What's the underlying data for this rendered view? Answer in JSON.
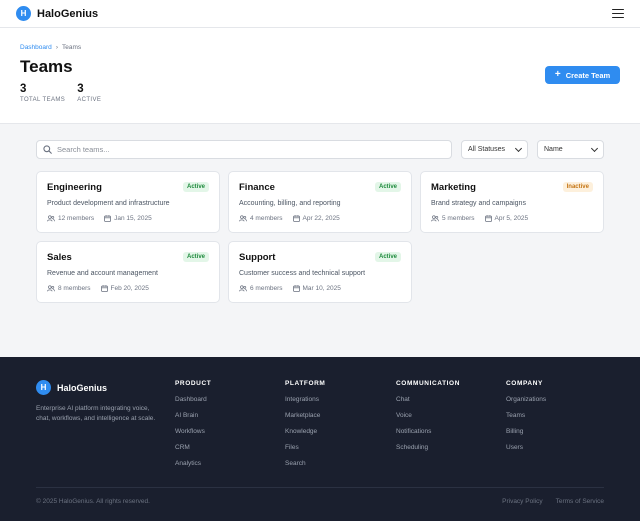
{
  "app": {
    "logo_letter": "H",
    "name": "HaloGenius"
  },
  "breadcrumb": {
    "parent": "Dashboard",
    "separator": "›",
    "current": "Teams"
  },
  "page": {
    "title": "Teams",
    "create_label": "Create Team"
  },
  "stats": [
    {
      "value": "3",
      "label": "TOTAL TEAMS"
    },
    {
      "value": "3",
      "label": "ACTIVE"
    }
  ],
  "filters": {
    "search_placeholder": "Search teams...",
    "status_selected": "All Statuses",
    "sort_selected": "Name"
  },
  "teams": [
    {
      "name": "Engineering",
      "status": "Active",
      "description": "Product development and infrastructure",
      "members": "12 members",
      "date": "Jan 15, 2025"
    },
    {
      "name": "Finance",
      "status": "Active",
      "description": "Accounting, billing, and reporting",
      "members": "4 members",
      "date": "Apr 22, 2025"
    },
    {
      "name": "Marketing",
      "status": "Inactive",
      "description": "Brand strategy and campaigns",
      "members": "5 members",
      "date": "Apr 5, 2025"
    },
    {
      "name": "Sales",
      "status": "Active",
      "description": "Revenue and account management",
      "members": "8 members",
      "date": "Feb 20, 2025"
    },
    {
      "name": "Support",
      "status": "Active",
      "description": "Customer success and technical support",
      "members": "6 members",
      "date": "Mar 10, 2025"
    }
  ],
  "footer": {
    "brand": "HaloGenius",
    "description": "Enterprise AI platform integrating voice, chat, workflows, and intelligence at scale.",
    "columns": [
      {
        "title": "PRODUCT",
        "links": [
          "Dashboard",
          "AI Brain",
          "Workflows",
          "CRM",
          "Analytics"
        ]
      },
      {
        "title": "PLATFORM",
        "links": [
          "Integrations",
          "Marketplace",
          "Knowledge",
          "Files",
          "Search"
        ]
      },
      {
        "title": "COMMUNICATION",
        "links": [
          "Chat",
          "Voice",
          "Notifications",
          "Scheduling"
        ]
      },
      {
        "title": "COMPANY",
        "links": [
          "Organizations",
          "Teams",
          "Billing",
          "Users"
        ]
      }
    ],
    "copyright": "© 2025 HaloGenius. All rights reserved.",
    "legal": [
      "Privacy Policy",
      "Terms of Service"
    ]
  },
  "colors": {
    "accent": "#2f8cf0",
    "footer_bg": "#1a1f2e",
    "active_badge": "#1e8a3c",
    "inactive_badge": "#c57514"
  }
}
